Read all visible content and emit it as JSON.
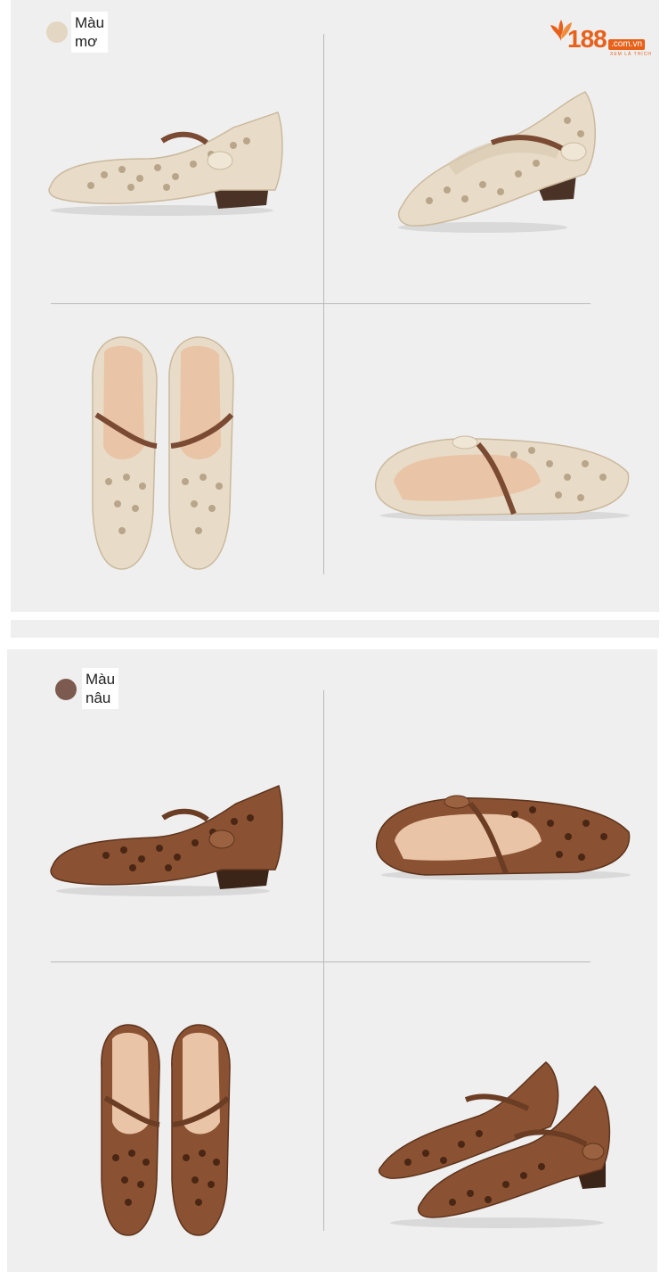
{
  "brand": {
    "number": "188",
    "domain": ".com.vn",
    "tagline": "XEM LÀ THÍCH",
    "accent": "#e8611a"
  },
  "variants": [
    {
      "label": "Màu\nmơ",
      "swatch_color": "#e3d6c2",
      "shoe_color": "#e8dcc8",
      "shoe_shadow": "#cbb99d",
      "strap_color": "#7a4a33"
    },
    {
      "label": "Màu\nnâu",
      "swatch_color": "#7d5a4f",
      "shoe_color": "#8a5232",
      "shoe_shadow": "#5e331c",
      "strap_color": "#6b3d24"
    }
  ]
}
